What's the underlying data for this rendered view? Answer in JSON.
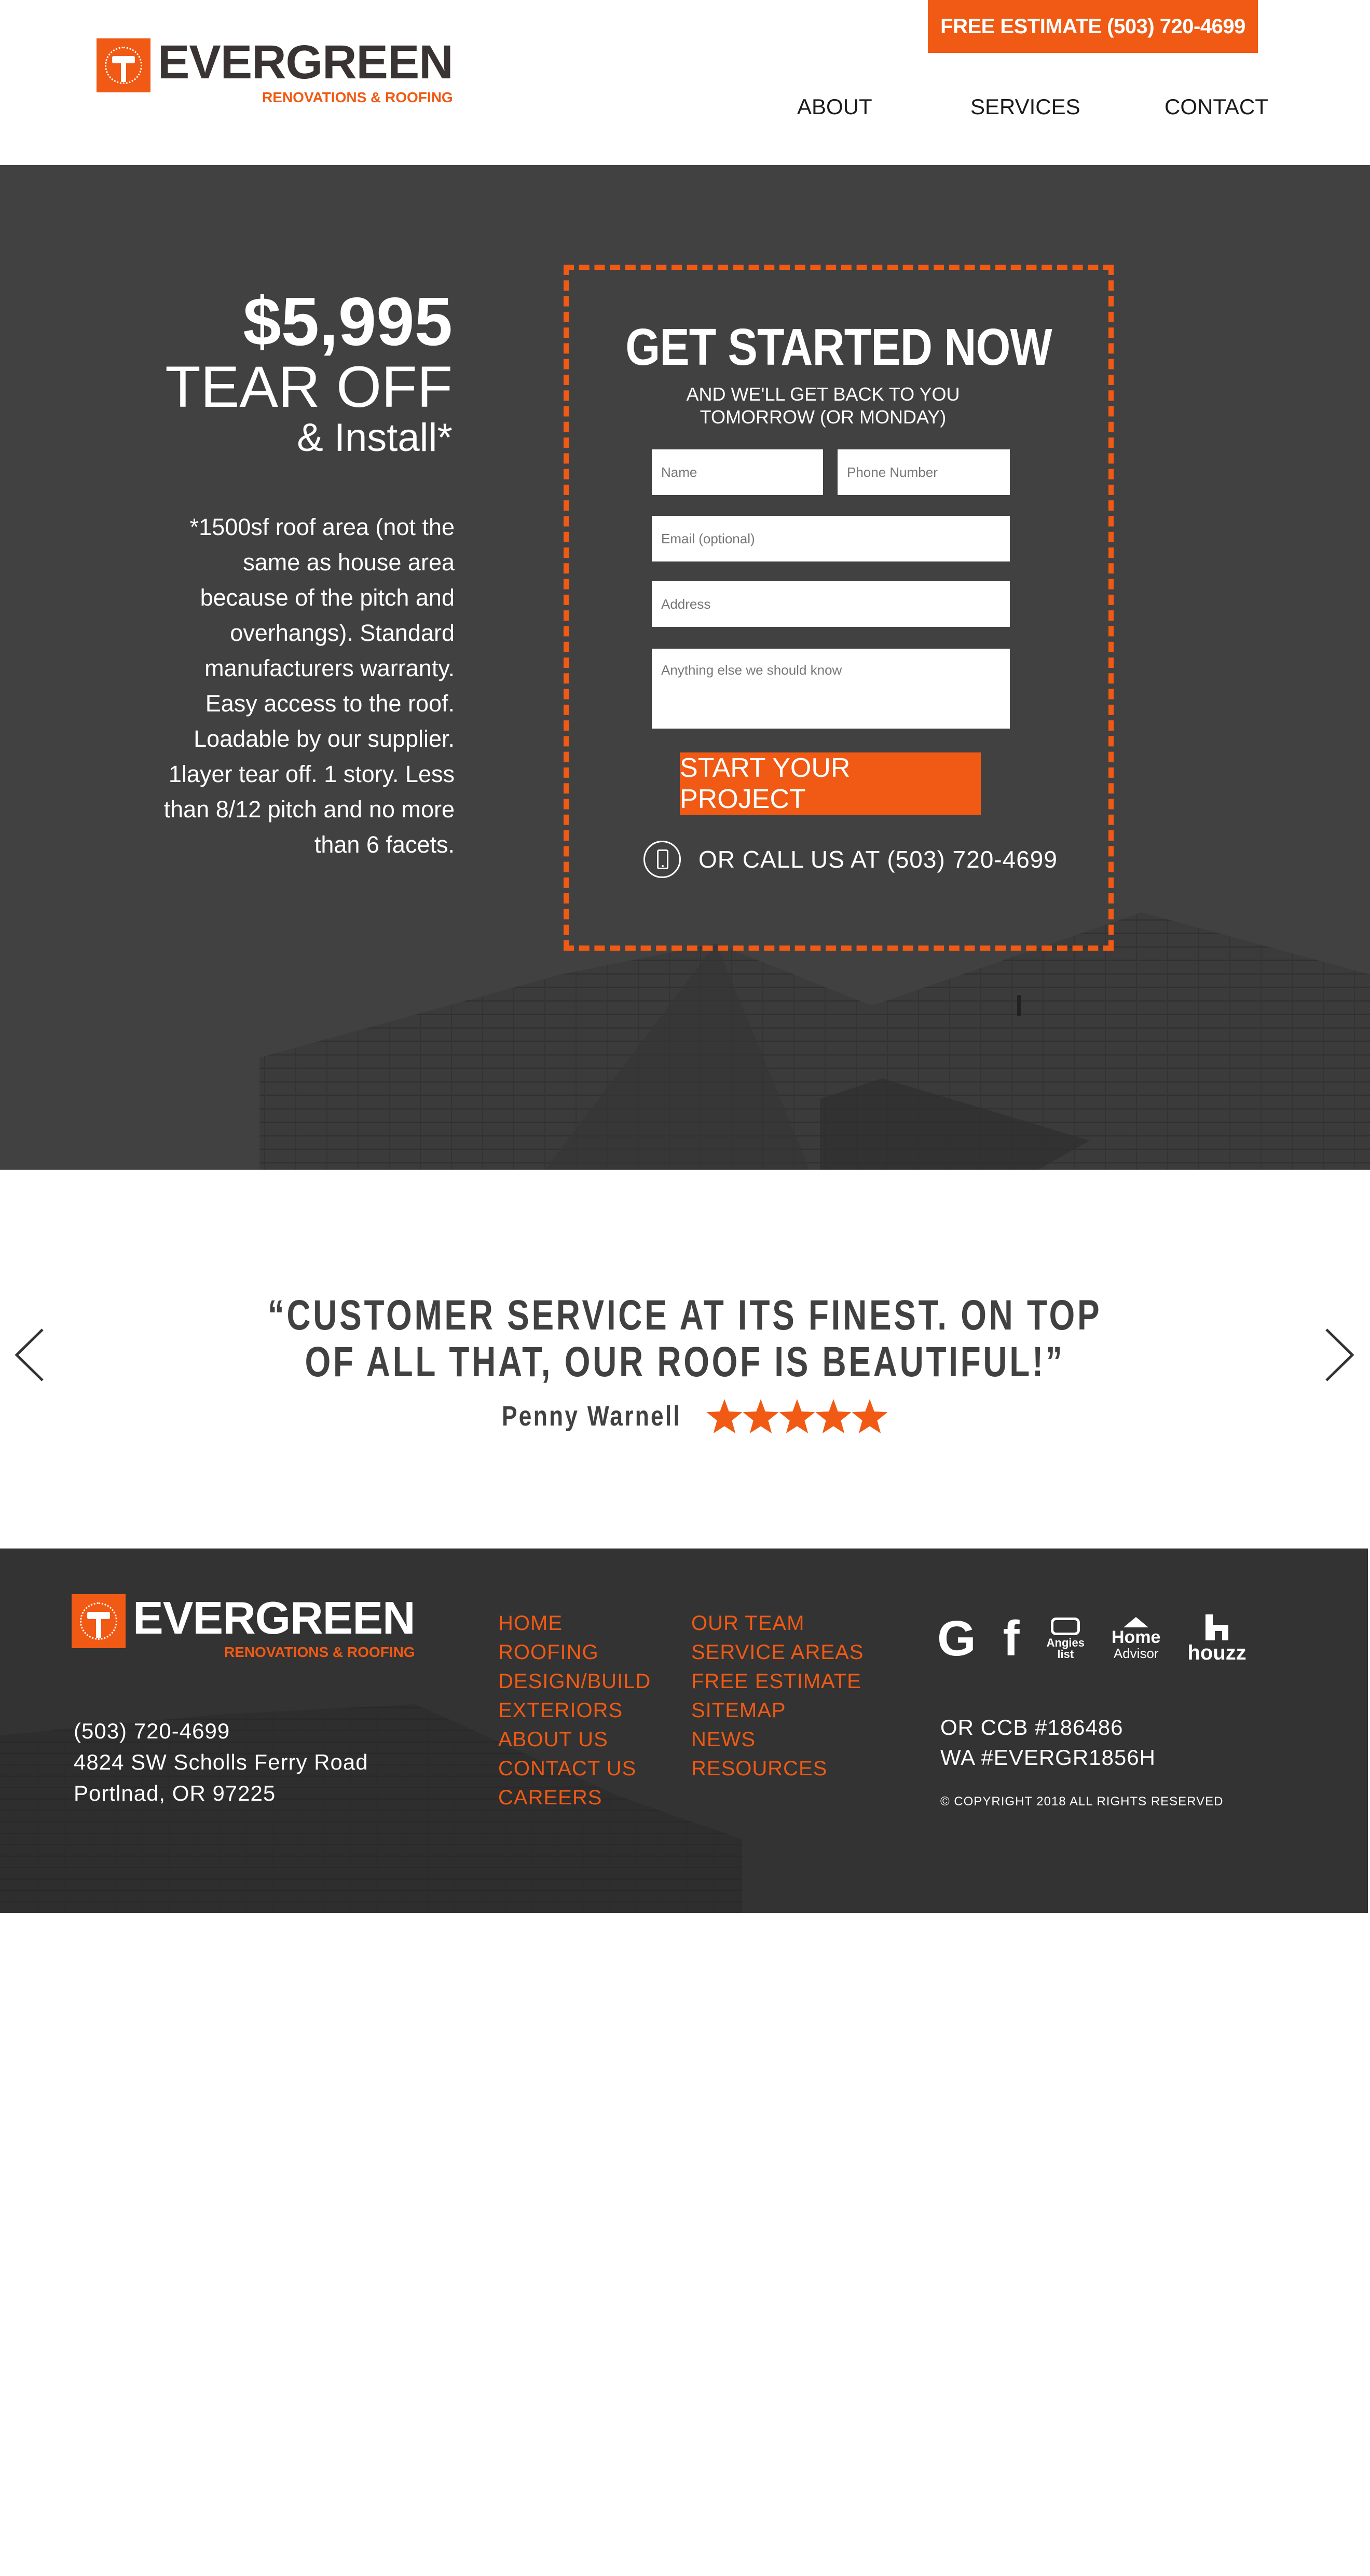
{
  "header": {
    "logo_word": "EVERGREEN",
    "logo_sub": "RENOVATIONS & ROOFING",
    "estimate_label": "FREE ESTIMATE (503) 720-4699",
    "nav": [
      "ABOUT",
      "SERVICES",
      "CONTACT"
    ]
  },
  "hero": {
    "price": "$5,995",
    "headline": "TEAR OFF",
    "subline": "& Install*",
    "disclaimer": "*1500sf roof area (not the same as house area because of the pitch and overhangs). Standard manufacturers warranty. Easy access to the roof. Loadable by our supplier. 1layer tear off. 1 story. Less than 8/12 pitch and no more than 6 facets."
  },
  "form": {
    "title": "GET STARTED NOW",
    "subtitle_line1": "AND WE'LL GET BACK TO YOU",
    "subtitle_line2": "TOMORROW (OR MONDAY)",
    "name_placeholder": "Name",
    "phone_placeholder": "Phone Number",
    "email_placeholder": "Email (optional)",
    "address_placeholder": "Address",
    "notes_placeholder": "Anything else we should know",
    "submit_label": "START YOUR PROJECT",
    "call_text": "OR CALL US AT (503) 720-4699"
  },
  "testimonial": {
    "quote_line1": "“CUSTOMER SERVICE AT ITS FINEST. ON TOP",
    "quote_line2": "OF ALL THAT, OUR ROOF IS BEAUTIFUL!”",
    "author": "Penny Warnell",
    "rating": 5
  },
  "footer": {
    "logo_word": "EVERGREEN",
    "logo_sub": "RENOVATIONS & ROOFING",
    "phone": "(503) 720-4699",
    "address_line1": "4824 SW Scholls Ferry Road",
    "address_line2": "Portlnad, OR  97225",
    "links_col1": [
      "HOME",
      "ROOFING",
      "DESIGN/BUILD",
      "EXTERIORS",
      "ABOUT US",
      "CONTACT US",
      "CAREERS"
    ],
    "links_col2": [
      "OUR TEAM",
      "SERVICE AREAS",
      "FREE ESTIMATE",
      "SITEMAP",
      "NEWS",
      "RESOURCES"
    ],
    "social": {
      "google": "G",
      "facebook": "f",
      "angies_line1": "Angies",
      "angies_line2": "list",
      "ha_line1": "Home",
      "ha_line2": "Advisor",
      "houzz": "houzz"
    },
    "license_or": "OR CCB #186486",
    "license_wa": "WA #EVERGR1856H",
    "copyright": "© COPYRIGHT 2018 ALL RIGHTS RESERVED"
  },
  "colors": {
    "accent": "#f05a14",
    "hero_bg": "#414141",
    "footer_bg": "#333333",
    "logo_dark": "#3a3334"
  }
}
